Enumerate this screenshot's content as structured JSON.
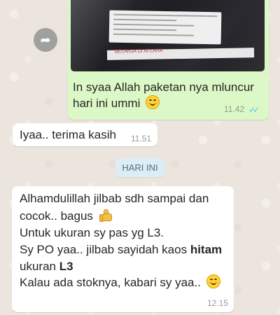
{
  "outgoing_image_message": {
    "icon": "shopping-package-photo",
    "caption": "In syaa Allah paketan nya mluncur hari ini ummi",
    "time": "11.42",
    "status_icon": "double-check-blue-icon",
    "emoji": "smiling-face-emoji",
    "package_strip_text": "BELANJA DI AFLAHA"
  },
  "incoming_message_1": {
    "text": "Iyaa.. terima kasih",
    "time": "11.51"
  },
  "date_separator": {
    "label": "HARI INI"
  },
  "incoming_message_2": {
    "line_1": "Alhamdulillah jilbab sdh sampai dan",
    "line_2": "cocok.. bagus",
    "line_3": "Untuk ukuran sy pas yg L3.",
    "line_4": "Sy PO yaa.. jilbab sayidah kaos",
    "bold_1": "hitam",
    "line_5_prefix": "ukuran",
    "bold_2": "L3",
    "line_6": "Kalau ada stoknya, kabari sy yaa..",
    "time": "12.15",
    "thumb_emoji": "thumbs-up-emoji",
    "smile_emoji": "smiling-face-emoji"
  },
  "colors": {
    "outgoing_bubble": "#dcf8c6",
    "incoming_bubble": "#ffffff",
    "wallpaper": "#ece5dd",
    "date_chip": "#dbeef7",
    "read_check": "#4fc3f7"
  },
  "icons": {
    "forward_button": "forward-arrow-icon"
  }
}
